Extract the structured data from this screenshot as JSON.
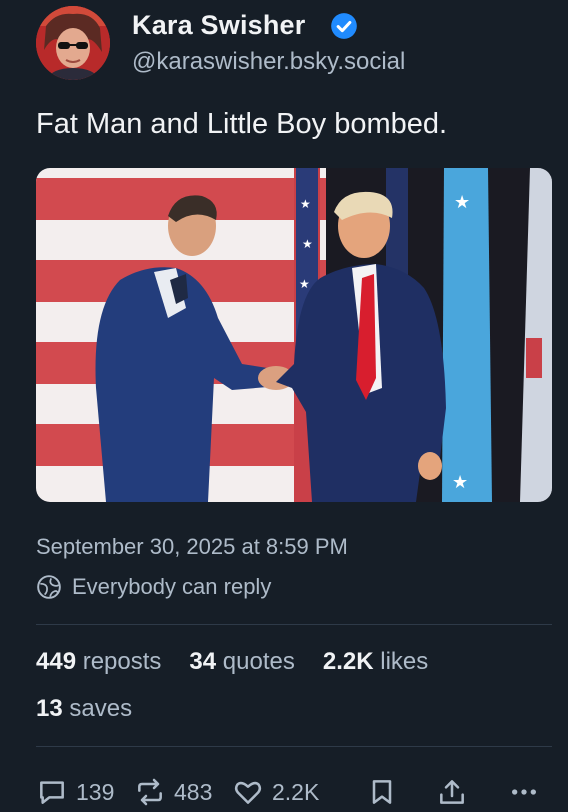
{
  "author": {
    "name": "Kara Swisher",
    "handle": "@karaswisher.bsky.social",
    "avatar_icon": "avatar-photo",
    "verified_icon": "verified-badge-icon"
  },
  "post": {
    "text": "Fat Man and Little Boy bombed.",
    "image_icon": "photo-handshake-on-stage"
  },
  "meta": {
    "timestamp": "September 30, 2025 at 8:59 PM",
    "reply_setting": "Everybody can reply",
    "reply_icon": "globe-icon"
  },
  "stats": {
    "reposts_count": "449",
    "reposts_label": "reposts",
    "quotes_count": "34",
    "quotes_label": "quotes",
    "likes_count": "2.2K",
    "likes_label": "likes",
    "saves_count": "13",
    "saves_label": "saves"
  },
  "actions": {
    "reply_count": "139",
    "repost_count": "483",
    "like_count": "2.2K",
    "reply_icon": "speech-bubble-icon",
    "repost_icon": "repost-arrows-icon",
    "like_icon": "heart-icon",
    "save_icon": "bookmark-icon",
    "share_icon": "share-icon",
    "more_icon": "more-dots-icon"
  },
  "colors": {
    "background": "#161e27",
    "text_primary": "#f1f3f5",
    "text_secondary": "#aebbc9",
    "verified": "#208bfe"
  }
}
